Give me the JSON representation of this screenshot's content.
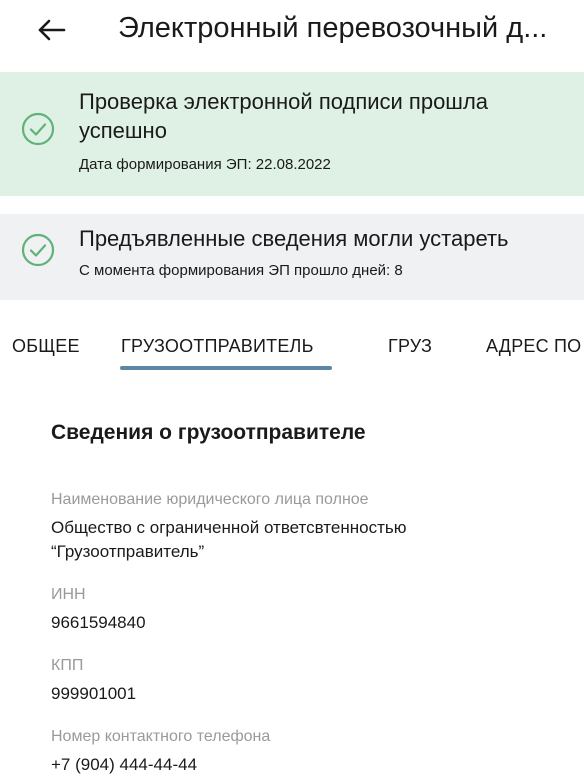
{
  "header": {
    "title": "Электронный перевозочный д..."
  },
  "signature_banner": {
    "title": "Проверка электронной подписи прошла успешно",
    "subtitle": "Дата формирования ЭП: 22.08.2022",
    "status_color": "#5fb27a"
  },
  "freshness_banner": {
    "title": "Предъявленные сведения могли устареть",
    "subtitle": "С момента формирования ЭП прошло дней: 8",
    "status_color": "#5fb27a"
  },
  "tabs": [
    {
      "label": "ОБЩЕЕ",
      "active": false
    },
    {
      "label": "ГРУЗООТПРАВИТЕЛЬ",
      "active": true
    },
    {
      "label": "ГРУЗ",
      "active": false
    },
    {
      "label": "АДРЕС ПО",
      "active": false
    }
  ],
  "accent_color": "#5b87a8",
  "section": {
    "title": "Сведения о грузоотправителе",
    "fields": [
      {
        "label": "Наименование юридического лица полное",
        "value": "Общество с ограниченной ответсвтенностью “Грузоотправитель”"
      },
      {
        "label": "ИНН",
        "value": "9661594840"
      },
      {
        "label": "КПП",
        "value": "999901001"
      },
      {
        "label": "Номер контактного телефона",
        "value": "+7 (904) 444-44-44"
      }
    ]
  }
}
